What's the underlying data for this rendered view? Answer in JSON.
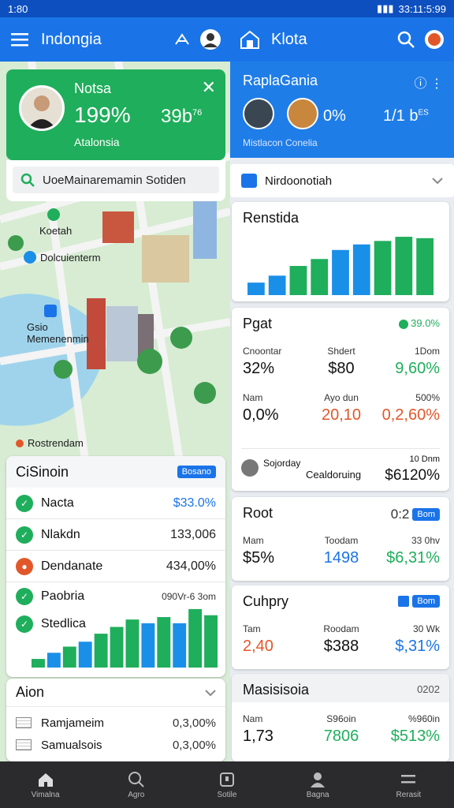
{
  "status": {
    "time": "1:80",
    "right_time": "33:11:5:99"
  },
  "left_app": {
    "title": "Indongia"
  },
  "right_app": {
    "title": "Klota"
  },
  "hero": {
    "name": "Notsa",
    "percent": "199%",
    "value": "39b",
    "value_sup": "76",
    "subtitle": "Atalonsia"
  },
  "search": {
    "text": "UoeMainaremamin Sotiden"
  },
  "map_labels": [
    "Koetah",
    "Dolcuienterm",
    "Gsio Memenenmin",
    "Rostrendam"
  ],
  "left_list": {
    "title": "CiSinoin",
    "badge": "Bosano",
    "rows": [
      {
        "label": "Nacta",
        "value": "$33.0%",
        "color": "#1fae5b",
        "value_color": "#1a74e8"
      },
      {
        "label": "Nlakdn",
        "value": "133,006",
        "color": "#1fae5b",
        "value_color": "#222222"
      },
      {
        "label": "Dendanate",
        "value": "434,00%",
        "color": "#e2572a",
        "value_color": "#222222"
      },
      {
        "label": "Paobria",
        "value": "090Vr-6 3om",
        "color": "#1fae5b",
        "value_color": "#333333"
      },
      {
        "label": "Stedlica",
        "value": "",
        "color": "#1fae5b",
        "value_color": "#222222"
      }
    ],
    "bars": [
      0.14,
      0.24,
      0.34,
      0.42,
      0.55,
      0.66,
      0.78,
      0.72,
      0.82,
      0.72,
      0.95,
      0.85
    ],
    "bar_colors": [
      "#1fae5b",
      "#1a8fe8",
      "#1fae5b",
      "#1a8fe8",
      "#1fae5b",
      "#1fae5b",
      "#1fae5b",
      "#1a8fe8",
      "#1fae5b",
      "#1a8fe8",
      "#1fae5b",
      "#1fae5b"
    ]
  },
  "aion": {
    "title": "Aion",
    "rows": [
      {
        "label": "Ramjameim",
        "value": "0,3,00%"
      },
      {
        "label": "Samualsois",
        "value": "0,3,00%"
      }
    ]
  },
  "right_hero": {
    "title": "RaplaGania",
    "pct": "0%",
    "num": "1/1 b",
    "num_sup": "ES",
    "subtitle": "Mistlacon Conelia"
  },
  "right_select": {
    "label": "Nirdoonotiah"
  },
  "rcard1": {
    "title": "Renstida",
    "bars": [
      0.18,
      0.28,
      0.42,
      0.52,
      0.65,
      0.73,
      0.78,
      0.84,
      0.82
    ],
    "bar_colors": [
      "#1a8fe8",
      "#1a8fe8",
      "#1fae5b",
      "#1fae5b",
      "#1a8fe8",
      "#1a8fe8",
      "#1fae5b",
      "#1fae5b",
      "#1fae5b"
    ]
  },
  "rcard2": {
    "title": "Pgat",
    "tag": "39.0%",
    "cells": [
      {
        "h": "Cnoontar",
        "v": "32%",
        "c": "#111111"
      },
      {
        "h": "Shdert",
        "v": "$80",
        "c": "#111111"
      },
      {
        "h": "1Dom",
        "v": "9,60%",
        "c": "#1fae5b"
      },
      {
        "h": "Nam",
        "v": "0,0%",
        "c": "#111111"
      },
      {
        "h": "Ayo dun",
        "v": "20,10",
        "c": "#e2572a"
      },
      {
        "h": "500%",
        "v": "0,2,60%",
        "c": "#e2572a"
      }
    ],
    "footer_label": "Sojorday",
    "footer_sub": "Cealdoruing",
    "footer_hint": "10 Dnm",
    "footer_value": "$6120%"
  },
  "rcard3": {
    "title": "Root",
    "tag": "0:2",
    "badge": "Bom",
    "cells": [
      {
        "h": "Mam",
        "v": "$5%",
        "c": "#111111"
      },
      {
        "h": "Toodam",
        "v": "1498",
        "c": "#1a74e8"
      },
      {
        "h": "33 0hv",
        "v": "$6,31%",
        "c": "#1fae5b"
      }
    ]
  },
  "rcard4": {
    "title": "Cuhpry",
    "badge": "Bom",
    "cells": [
      {
        "h": "Tam",
        "v": "2,40",
        "c": "#e2572a"
      },
      {
        "h": "Roodam",
        "v": "$388",
        "c": "#111111"
      },
      {
        "h": "30 Wk",
        "v": "$,31%",
        "c": "#1a74e8"
      }
    ]
  },
  "rcard5": {
    "title": "Masisisoia",
    "tag": "0202",
    "cells": [
      {
        "h": "Nam",
        "v": "1,73",
        "c": "#111111"
      },
      {
        "h": "S96oin",
        "v": "7806",
        "c": "#1fae5b"
      },
      {
        "h": "%960in",
        "v": "$513%",
        "c": "#1fae5b"
      }
    ]
  },
  "bottom_nav": [
    {
      "label": "Vimalna",
      "icon": "home-icon"
    },
    {
      "label": "Agro",
      "icon": "search-icon"
    },
    {
      "label": "Sotile",
      "icon": "square-icon"
    },
    {
      "label": "Bagna",
      "icon": "person-icon"
    },
    {
      "label": "Rerasit",
      "icon": "menu-icon"
    }
  ]
}
